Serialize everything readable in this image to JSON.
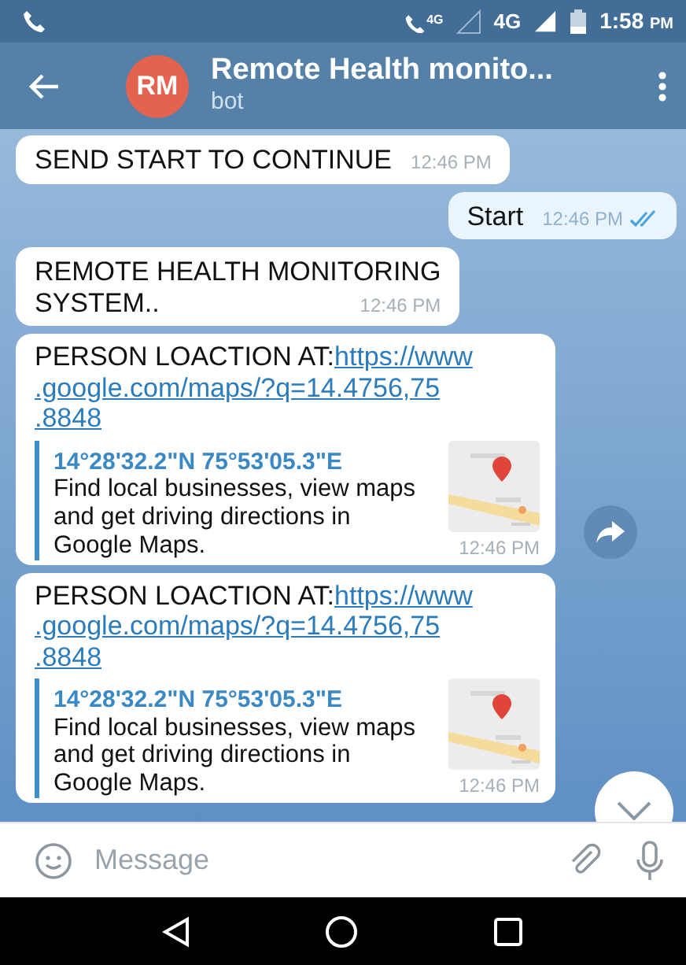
{
  "status_bar": {
    "call_network": "4G",
    "network": "4G",
    "time": "1:58",
    "meridiem": "PM"
  },
  "header": {
    "avatar_initials": "RM",
    "title": "Remote Health monito...",
    "subtitle": "bot"
  },
  "messages": [
    {
      "kind": "text",
      "outgoing": false,
      "text": "SEND START TO CONTINUE",
      "time": "12:46 PM"
    },
    {
      "kind": "text",
      "outgoing": true,
      "text": "Start",
      "time": "12:46 PM",
      "read": true
    },
    {
      "kind": "text",
      "outgoing": false,
      "text_lines": [
        "REMOTE HEALTH MONITORING",
        "SYSTEM.."
      ],
      "time": "12:46 PM"
    },
    {
      "kind": "link_preview",
      "outgoing": false,
      "prefix": "PERSON LOACTION AT:",
      "url_lines": [
        "https://www",
        ".google.com/maps/?q=14.4756,75",
        ".8848"
      ],
      "preview_title": "14°28'32.2\"N 75°53'05.3\"E",
      "preview_text": "Find local businesses, view maps and get driving directions in Google Maps.",
      "time": "12:46 PM",
      "share_button": true
    },
    {
      "kind": "link_preview",
      "outgoing": false,
      "prefix": "PERSON LOACTION AT:",
      "url_lines": [
        "https://www",
        ".google.com/maps/?q=14.4756,75",
        ".8848"
      ],
      "preview_title": "14°28'32.2\"N 75°53'05.3\"E",
      "preview_text": "Find local businesses, view maps and get driving directions in Google Maps.",
      "time": "12:46 PM",
      "share_button": false
    }
  ],
  "input": {
    "placeholder": "Message"
  }
}
